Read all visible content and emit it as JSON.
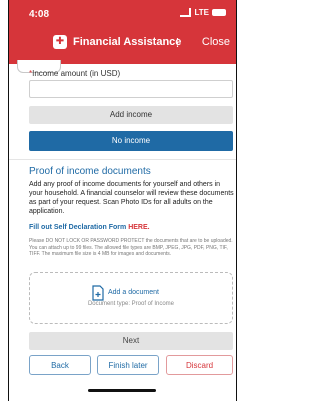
{
  "status": {
    "time": "4:08",
    "carrier": "LTE"
  },
  "header": {
    "title": "Financial Assistance",
    "separator": "⋮",
    "close_label": "Close",
    "app_icon": "hospital-icon"
  },
  "partial_field": {
    "label": ""
  },
  "income": {
    "label": "Income amount (in USD)",
    "required_mark": "*",
    "value": "",
    "add_label": "Add income",
    "no_income_label": "No income"
  },
  "proof": {
    "title": "Proof of income documents",
    "description": "Add any proof of income documents for yourself and others in your household. A financial counselor will review these documents as part of your request. Scan Photo IDs for all adults on the application.",
    "self_declaration_prefix": "Fill out Self Declaration Form ",
    "self_declaration_link": "HERE.",
    "warning": "Please DO NOT LOCK OR PASSWORD PROTECT the documents that are to be uploaded. You can attach up to 99 files. The allowed file types are BMP, JPEG, JPG, PDF, PNG, TIF, TIFF. The maximum file size is 4 MB for images and documents.",
    "upload_label": "Add a document",
    "upload_type": "Document type: Proof of Income"
  },
  "footer": {
    "next_label": "Next",
    "back_label": "Back",
    "finish_label": "Finish later",
    "discard_label": "Discard"
  },
  "colors": {
    "brand_red": "#d6353a",
    "primary_blue": "#1f6aa5",
    "disabled_gray": "#e3e3e3"
  }
}
